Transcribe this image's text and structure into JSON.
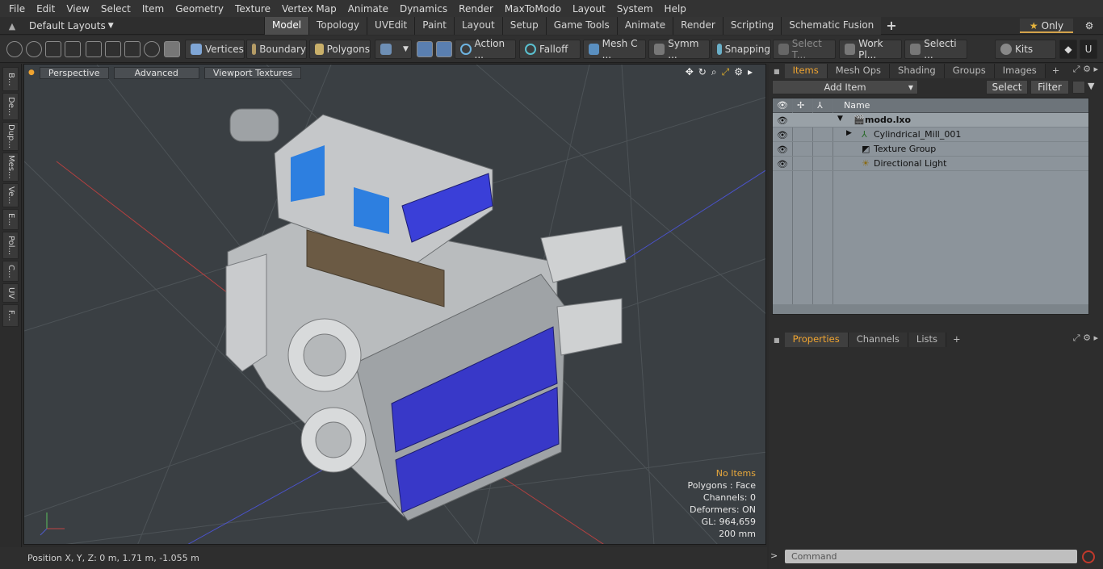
{
  "menu": [
    "File",
    "Edit",
    "View",
    "Select",
    "Item",
    "Geometry",
    "Texture",
    "Vertex Map",
    "Animate",
    "Dynamics",
    "Render",
    "MaxToModo",
    "Layout",
    "System",
    "Help"
  ],
  "layouts_label": "Default Layouts",
  "tabs": [
    "Model",
    "Topology",
    "UVEdit",
    "Paint",
    "Layout",
    "Setup",
    "Game Tools",
    "Animate",
    "Render",
    "Scripting",
    "Schematic Fusion"
  ],
  "active_tab": "Model",
  "only_label": "Only",
  "toolbar": {
    "vertices": "Vertices",
    "boundary": "Boundary",
    "polygons": "Polygons",
    "action": "Action ...",
    "falloff": "Falloff",
    "meshc": "Mesh C ...",
    "symm": "Symm ...",
    "snapping": "Snapping",
    "selectt": "Select T...",
    "workpl": "Work Pl...",
    "selecti": "Selecti ...",
    "kits": "Kits"
  },
  "left_tabs": [
    "B...",
    "De...",
    "Dup...",
    "Mes...",
    "Ve...",
    "E...",
    "Pol...",
    "C...",
    "UV",
    "F..."
  ],
  "viewport": {
    "perspective": "Perspective",
    "advanced": "Advanced",
    "textures": "Viewport Textures",
    "info": {
      "no_items": "No Items",
      "polygons": "Polygons : Face",
      "channels": "Channels: 0",
      "deformers": "Deformers: ON",
      "gl": "GL: 964,659",
      "scale": "200 mm"
    }
  },
  "status": {
    "position": "Position X, Y, Z:   0 m, 1.71 m, -1.055 m"
  },
  "right": {
    "tabs": [
      "Items",
      "Mesh Ops",
      "Shading",
      "Groups",
      "Images"
    ],
    "active_tab": "Items",
    "add_item": "Add Item",
    "select": "Select",
    "filter": "Filter",
    "name_header": "Name",
    "tree": [
      {
        "name": "modo.lxo",
        "indent": 0
      },
      {
        "name": "Cylindrical_Mill_001",
        "indent": 1
      },
      {
        "name": "Texture Group",
        "indent": 1
      },
      {
        "name": "Directional Light",
        "indent": 1
      }
    ],
    "prop_tabs": [
      "Properties",
      "Channels",
      "Lists"
    ],
    "prop_active": "Properties",
    "command_placeholder": "Command"
  },
  "colors": {
    "accent": "#f0a430",
    "machine_blue": "#3a3fd8",
    "panel_blue": "#2d7fe0"
  }
}
